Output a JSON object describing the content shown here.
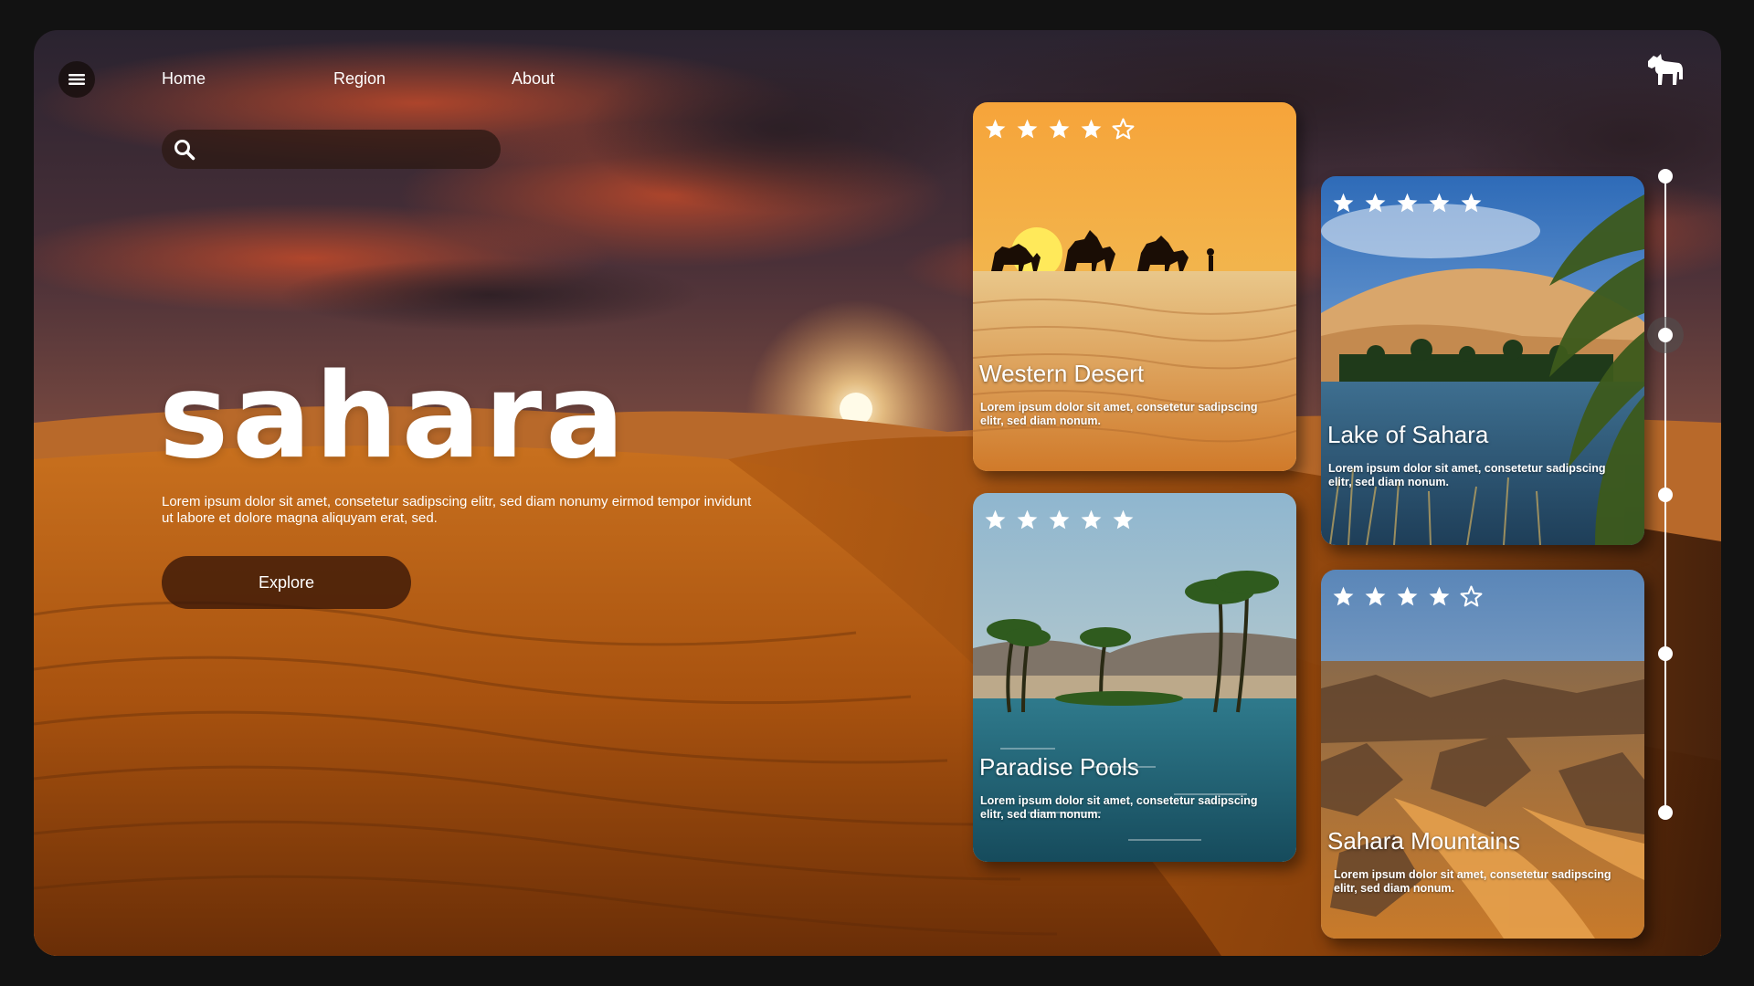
{
  "nav": {
    "menu_icon": "hamburger-menu-icon",
    "links": [
      "Home",
      "Region",
      "About"
    ]
  },
  "search": {
    "icon": "search-icon",
    "placeholder": "",
    "value": ""
  },
  "logo": {
    "icon": "horse-icon"
  },
  "hero": {
    "title": "sahara",
    "description": "Lorem ipsum dolor sit amet, consetetur sadipscing elitr, sed diam nonumy eirmod tempor invidunt ut labore et dolore magna aliquyam erat, sed.",
    "button_label": "Explore"
  },
  "cards": [
    {
      "title": "Western Desert",
      "description": "Lorem ipsum dolor sit amet, consetetur sadipscing elitr, sed diam nonum.",
      "rating": 4,
      "max_rating": 5
    },
    {
      "title": "Lake of Sahara",
      "description": "Lorem ipsum dolor sit amet, consetetur sadipscing elitr, sed diam nonum.",
      "rating": 5,
      "max_rating": 5
    },
    {
      "title": "Paradise Pools",
      "description": "Lorem ipsum dolor sit amet, consetetur sadipscing elitr, sed diam nonum.",
      "rating": 5,
      "max_rating": 5
    },
    {
      "title": "Sahara Mountains",
      "description": "Lorem ipsum dolor sit amet, consetetur sadipscing elitr, sed diam nonum.",
      "rating": 4,
      "max_rating": 5
    }
  ],
  "timeline": {
    "steps": 5,
    "active_step": 2
  },
  "colors": {
    "page_background": "#121212",
    "star": "#ffffff",
    "accent": "#d9821e"
  }
}
